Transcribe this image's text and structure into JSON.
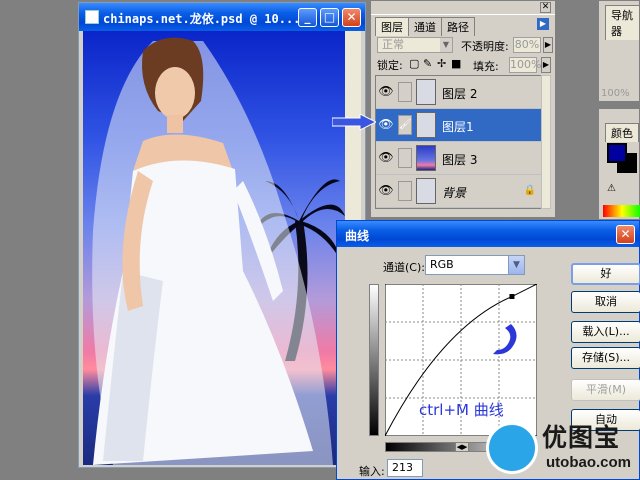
{
  "document": {
    "title": "chinaps.net.龙依.psd @ 10..."
  },
  "layers_panel": {
    "tabs": [
      "图层",
      "通道",
      "路径"
    ],
    "blend_mode": "正常",
    "opacity_label": "不透明度:",
    "opacity_value": "80%",
    "lock_label": "锁定:",
    "fill_label": "填充:",
    "fill_value": "100%",
    "layers": [
      {
        "name": "图层 2",
        "selected": false
      },
      {
        "name": "图层1",
        "selected": true
      },
      {
        "name": "图层 3",
        "selected": false
      },
      {
        "name": "背景",
        "selected": false,
        "locked": true
      }
    ]
  },
  "navigator_panel": {
    "tab": "导航器",
    "zoom": "100%"
  },
  "color_panel": {
    "tab": "颜色",
    "foreground": "#0000a0",
    "background": "#000000"
  },
  "curves_dialog": {
    "title": "曲线",
    "channel_label": "通道(C):",
    "channel_value": "RGB",
    "annotation": "ctrl+M 曲线",
    "input_label": "输入:",
    "input_value": "213",
    "buttons": {
      "ok": "好",
      "cancel": "取消",
      "load": "载入(L)...",
      "save": "存储(S)...",
      "smooth": "平滑(M)",
      "auto": "自动"
    },
    "curve_point": {
      "input": 213,
      "output": 234
    }
  },
  "watermark": {
    "brand": "优图宝",
    "url": "utobao.com"
  },
  "colors": {
    "xp_title": "#0a5fe6",
    "selection": "#316ac5",
    "annotation": "#2b37d9"
  }
}
